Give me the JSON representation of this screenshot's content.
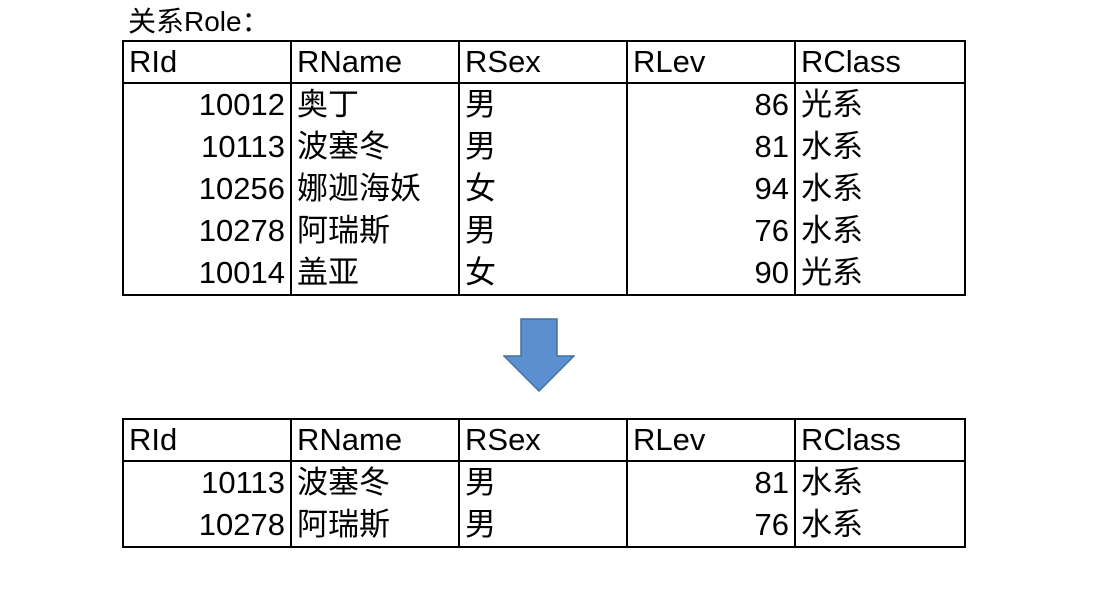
{
  "caption": "关系Role：",
  "columns": [
    "RId",
    "RName",
    "RSex",
    "RLev",
    "RClass"
  ],
  "source_rows": [
    [
      "10012",
      "奥丁",
      "男",
      "86",
      "光系"
    ],
    [
      "10113",
      "波塞冬",
      "男",
      "81",
      "水系"
    ],
    [
      "10256",
      "娜迦海妖",
      "女",
      "94",
      "水系"
    ],
    [
      "10278",
      "阿瑞斯",
      "男",
      "76",
      "水系"
    ],
    [
      "10014",
      "盖亚",
      "女",
      "90",
      "光系"
    ]
  ],
  "result_rows": [
    [
      "10113",
      "波塞冬",
      "男",
      "81",
      "水系"
    ],
    [
      "10278",
      "阿瑞斯",
      "男",
      "76",
      "水系"
    ]
  ],
  "arrow": {
    "icon": "down-arrow-icon",
    "fill": "#5B8FD0",
    "stroke": "#41719C"
  }
}
